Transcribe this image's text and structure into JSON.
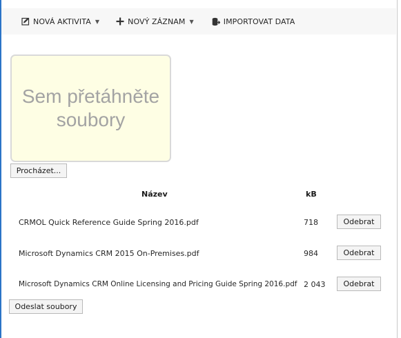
{
  "toolbar": {
    "new_activity": "NOVÁ AKTIVITA",
    "new_record": "NOVÝ ZÁZNAM",
    "import_data": "IMPORTOVAT DATA"
  },
  "dropzone": {
    "text": "Sem přetáhněte soubory"
  },
  "browse_label": "Procházet...",
  "table": {
    "headers": {
      "name": "Název",
      "kb": "kB"
    },
    "rows": [
      {
        "name": "CRMOL Quick Reference Guide Spring 2016.pdf",
        "kb": "718",
        "action": "Odebrat"
      },
      {
        "name": "Microsoft Dynamics CRM 2015 On-Premises.pdf",
        "kb": "984",
        "action": "Odebrat"
      },
      {
        "name": "Microsoft Dynamics CRM Online Licensing and Pricing Guide Spring 2016.pdf",
        "kb": "2 043",
        "action": "Odebrat"
      }
    ]
  },
  "send_label": "Odeslat soubory",
  "colors": {
    "accent": "#2b74c7",
    "dropzone_bg": "#fefee4",
    "dropzone_text": "#a3a3a3",
    "toolbar_bg": "#f7f7f7"
  },
  "icons": [
    "activity-icon",
    "plus-icon",
    "import-icon",
    "caret-down-icon"
  ]
}
